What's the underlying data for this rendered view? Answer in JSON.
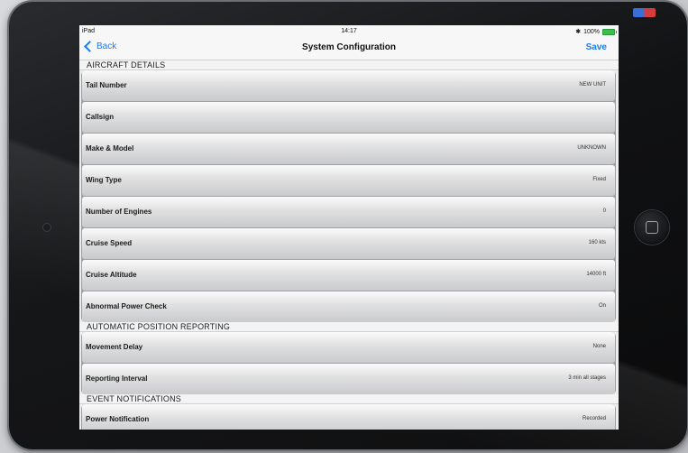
{
  "status_bar": {
    "device": "iPad",
    "time": "14:17",
    "battery": "100%",
    "bluetooth_glyph": "✱"
  },
  "nav": {
    "back_label": "Back",
    "title": "System Configuration",
    "save_label": "Save"
  },
  "sections": [
    {
      "header": "AIRCRAFT DETAILS",
      "rows": [
        {
          "label": "Tail Number",
          "value": "NEW UNIT"
        },
        {
          "label": "Callsign",
          "value": ""
        },
        {
          "label": "Make & Model",
          "value": "UNKNOWN"
        },
        {
          "label": "Wing Type",
          "value": "Fixed"
        },
        {
          "label": "Number of Engines",
          "value": "0"
        },
        {
          "label": "Cruise Speed",
          "value": "160 kts"
        },
        {
          "label": "Cruise Altitude",
          "value": "14000 ft"
        },
        {
          "label": "Abnormal Power Check",
          "value": "On"
        }
      ]
    },
    {
      "header": "AUTOMATIC POSITION REPORTING",
      "rows": [
        {
          "label": "Movement Delay",
          "value": "None"
        },
        {
          "label": "Reporting Interval",
          "value": "3 min all stages"
        }
      ]
    },
    {
      "header": "EVENT NOTIFICATIONS",
      "rows": [
        {
          "label": "Power Notification",
          "value": "Recorded"
        }
      ]
    }
  ],
  "colors": {
    "accent": "#1a7cf5",
    "battery": "#39c04a"
  }
}
